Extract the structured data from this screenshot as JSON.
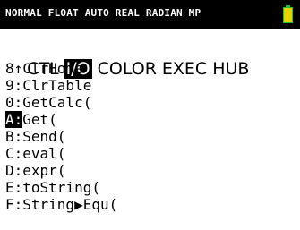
{
  "status": {
    "mode_text": "NORMAL FLOAT AUTO REAL RADIAN MP",
    "battery_icon": "battery-icon",
    "colors": {
      "bar": "#000000",
      "text": "#ffffff",
      "battery_green": "#1fbf3a",
      "battery_yellow": "#e6d200"
    }
  },
  "tabs": [
    {
      "label": "CTL",
      "active": false
    },
    {
      "label": "I/O",
      "active": true
    },
    {
      "label": "COLOR",
      "active": false
    },
    {
      "label": "EXEC",
      "active": false
    },
    {
      "label": "HUB",
      "active": false
    }
  ],
  "menu": {
    "items": [
      {
        "key": "8↑",
        "text": "ClrHome",
        "selected": false
      },
      {
        "key": "9:",
        "text": "ClrTable",
        "selected": false
      },
      {
        "key": "0:",
        "text": "GetCalc(",
        "selected": false
      },
      {
        "key": "A:",
        "text": "Get(",
        "selected": true
      },
      {
        "key": "B:",
        "text": "Send(",
        "selected": false
      },
      {
        "key": "C:",
        "text": "eval(",
        "selected": false
      },
      {
        "key": "D:",
        "text": "expr(",
        "selected": false
      },
      {
        "key": "E:",
        "text": "toString(",
        "selected": false
      },
      {
        "key": "F:",
        "text": "String▶Equ(",
        "selected": false
      }
    ]
  }
}
